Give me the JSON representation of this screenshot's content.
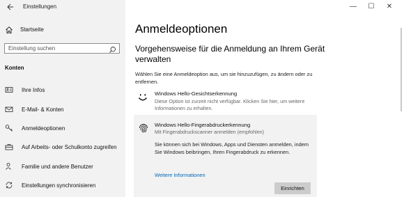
{
  "window": {
    "title": "Einstellungen",
    "back_icon": "back-arrow-icon",
    "controls": [
      "—",
      "☐",
      "✕"
    ]
  },
  "sidebar": {
    "home_label": "Startseite",
    "search_placeholder": "Einstellung suchen",
    "section_label": "Konten",
    "items": [
      {
        "label": "Ihre Infos",
        "icon": "person-card-icon"
      },
      {
        "label": "E-Mail- & Konten",
        "icon": "mail-icon"
      },
      {
        "label": "Anmeldeoptionen",
        "icon": "key-icon"
      },
      {
        "label": "Auf Arbeits- oder Schulkonto zugreifen",
        "icon": "briefcase-icon"
      },
      {
        "label": "Familie und andere Benutzer",
        "icon": "person-add-icon"
      },
      {
        "label": "Einstellungen synchronisieren",
        "icon": "sync-icon"
      }
    ]
  },
  "main": {
    "page_title": "Anmeldeoptionen",
    "section_title": "Vorgehensweise für die Anmeldung an Ihrem Gerät verwalten",
    "intro": "Wählen Sie eine Anmeldeoption aus, um sie hinzuzufügen, zu ändern oder zu entfernen.",
    "options": [
      {
        "title": "Windows Hello-Gesichtserkennung",
        "description": "Diese Option ist zurzeit nicht verfügbar. Klicken Sie hier, um weitere Informationen zu erhalten.",
        "icon": "face-icon"
      },
      {
        "title": "Windows Hello-Fingerabdruckerkennung",
        "subtitle": "Mit Fingerabdruckscanner anmelden (empfohlen)",
        "body": "Sie können sich bei Windows, Apps und Diensten anmelden, indem Sie Windows beibringen, Ihren Fingerabdruck zu erkennen.",
        "link": "Weitere Informationen",
        "button": "Einrichten",
        "icon": "fingerprint-icon"
      }
    ]
  },
  "colors": {
    "sidebar_bg": "#f2f2f2",
    "link": "#0067b8",
    "button_bg": "#cccccc"
  }
}
